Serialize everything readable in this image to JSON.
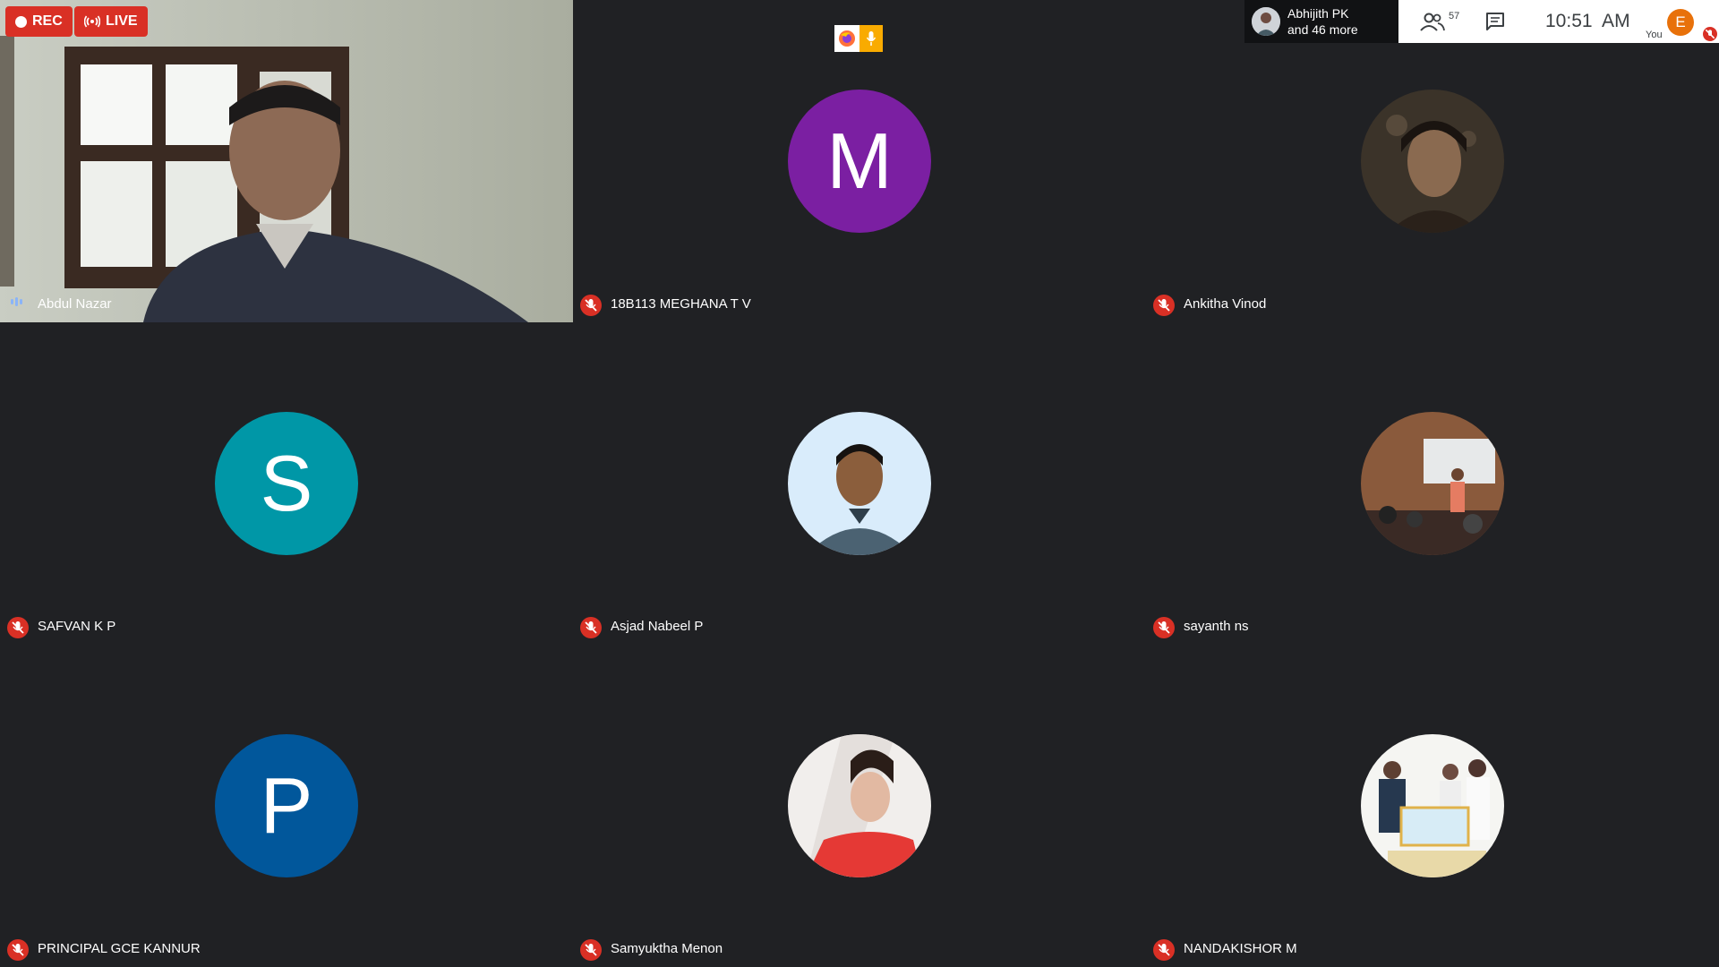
{
  "recording": {
    "rec_label": "REC",
    "live_label": "LIVE"
  },
  "presenter": {
    "name": "Abhijith PK",
    "more": "and 46 more"
  },
  "topbar": {
    "participant_count": "57",
    "time": "10:51  AM",
    "self_initial": "E",
    "self_label": "You"
  },
  "colors": {
    "mute_red": "#d93025",
    "tile_bg": "#202124",
    "speaking_blue": "#8ab4f8"
  },
  "tiles": [
    {
      "name": "Abdul Nazar",
      "type": "video",
      "muted": false,
      "speaking": true
    },
    {
      "name": "18B113 MEGHANA T V",
      "type": "initial",
      "initial": "M",
      "color": "#7b1fa2",
      "muted": true
    },
    {
      "name": "Ankitha Vinod",
      "type": "photo",
      "icon": "portrait-photo-icon",
      "muted": true
    },
    {
      "name": "SAFVAN K P",
      "type": "initial",
      "initial": "S",
      "color": "#0097a7",
      "muted": true
    },
    {
      "name": "Asjad Nabeel P",
      "type": "photo",
      "icon": "portrait-photo-icon",
      "muted": true
    },
    {
      "name": "sayanth ns",
      "type": "photo",
      "icon": "classroom-photo-icon",
      "muted": true
    },
    {
      "name": "PRINCIPAL GCE KANNUR",
      "type": "initial",
      "initial": "P",
      "color": "#01579b",
      "muted": true
    },
    {
      "name": "Samyuktha Menon",
      "type": "photo",
      "icon": "portrait-photo-icon",
      "muted": true
    },
    {
      "name": "NANDAKISHOR M",
      "type": "photo",
      "icon": "award-photo-icon",
      "muted": true
    }
  ]
}
